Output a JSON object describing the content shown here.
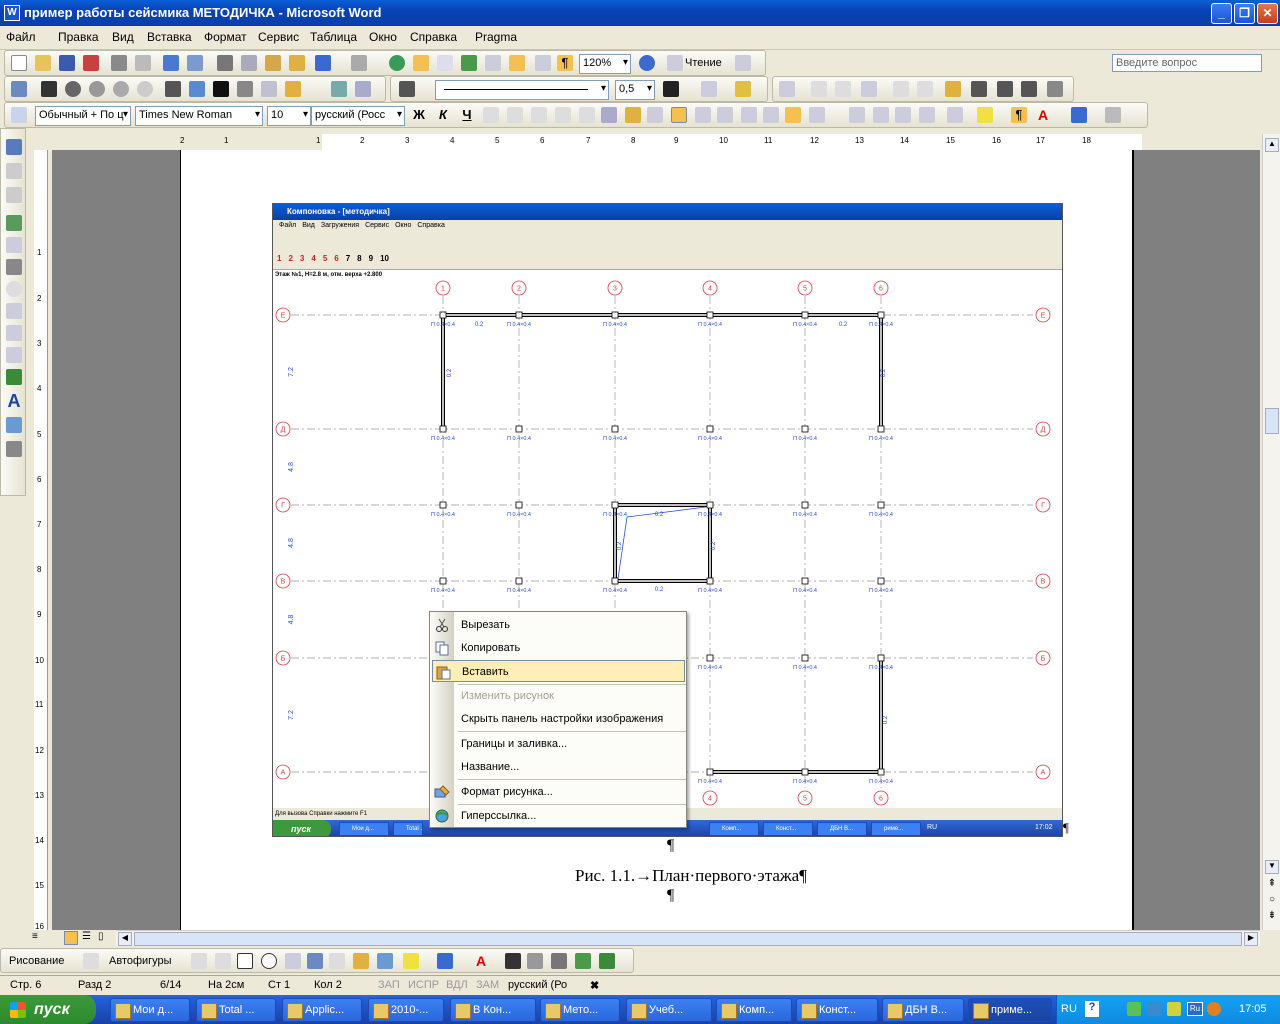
{
  "window": {
    "title": "пример работы сейсмика МЕТОДИЧКА - Microsoft Word",
    "app_icon": "W"
  },
  "menu": [
    "Файл",
    "Правка",
    "Вид",
    "Вставка",
    "Формат",
    "Сервис",
    "Таблица",
    "Окно",
    "Справка",
    "Pragma"
  ],
  "ask_placeholder": "Введите вопрос",
  "toolbar_standard": {
    "zoom": "120%",
    "read_label": "Чтение"
  },
  "toolbar_drawing_props": {
    "line_weight": "0,5"
  },
  "toolbar_format": {
    "style": "Обычный + По ц",
    "font": "Times New Roman",
    "size": "10",
    "language": "русский (Росс"
  },
  "ruler_numbers": [
    "2",
    "1",
    "1",
    "2",
    "3",
    "4",
    "5",
    "6",
    "7",
    "8",
    "9",
    "10",
    "11",
    "12",
    "13",
    "14",
    "15",
    "16",
    "17",
    "18"
  ],
  "vruler_numbers": [
    "1",
    "2",
    "3",
    "4",
    "5",
    "6",
    "7",
    "8",
    "9",
    "10",
    "11",
    "12",
    "13",
    "14",
    "15",
    "16"
  ],
  "embedded": {
    "title": "Компоновка - [методичка]",
    "menu": [
      "Файл",
      "Вид",
      "Загружения",
      "Сервис",
      "Окно",
      "Справка"
    ],
    "floor_tabs": [
      "1",
      "2",
      "3",
      "4",
      "5",
      "6",
      "7",
      "8",
      "9",
      "10"
    ],
    "info": "Этаж №1, Н=2.8 м, отм. верха +2.800",
    "status": "Для вызова Справки нажмите F1",
    "axes_top": [
      "1",
      "2",
      "3",
      "4",
      "5",
      "6"
    ],
    "axes_left": [
      "Е",
      "Д",
      "Г",
      "В",
      "Б",
      "А"
    ],
    "spans": [
      "7.2",
      "4.8",
      "4.8",
      "4.8",
      "7.2"
    ],
    "node_label": "П 0.4×0.4",
    "wall_label": "0.2",
    "taskbar": {
      "start": "пуск",
      "items": [
        "Мои д...",
        "Total ...",
        "",
        "",
        "",
        "",
        "",
        "Комп...",
        "Конст...",
        "ДБН В...",
        "риме..."
      ],
      "lang": "RU",
      "clock": "17:02"
    }
  },
  "caption": "Рис. 1.1.→План·первого·этажа¶",
  "pilcrow": "¶",
  "context_menu": [
    {
      "label": "Вырезать",
      "icon": "scissors-icon",
      "enabled": true
    },
    {
      "label": "Копировать",
      "icon": "copy-icon",
      "enabled": true
    },
    {
      "label": "Вставить",
      "icon": "paste-icon",
      "enabled": true,
      "highlighted": true
    },
    {
      "label": "Изменить рисунок",
      "enabled": false
    },
    {
      "label": "Скрыть панель настройки изображения",
      "enabled": true
    },
    {
      "label": "Границы и заливка...",
      "enabled": true
    },
    {
      "label": "Название...",
      "enabled": true
    },
    {
      "label": "Формат рисунка...",
      "icon": "format-picture-icon",
      "enabled": true
    },
    {
      "label": "Гиперссылка...",
      "icon": "hyperlink-icon",
      "enabled": true
    }
  ],
  "drawing_bar": {
    "draw_label": "Рисование",
    "autoshapes_label": "Автофигуры"
  },
  "status": {
    "page": "Стр. 6",
    "section": "Разд 2",
    "pages": "6/14",
    "at": "На 2см",
    "line": "Ст 1",
    "col": "Кол 2",
    "rec": "ЗАП",
    "trk": "ИСПР",
    "ext": "ВДЛ",
    "ovr": "ЗАМ",
    "lang": "русский (Ро"
  },
  "taskbar": {
    "start": "пуск",
    "items": [
      "Мои д...",
      "Total ...",
      "Applic...",
      "2010-...",
      "В Кон...",
      "Мето...",
      "Учеб...",
      "Комп...",
      "Конст...",
      "ДБН В...",
      "приме..."
    ],
    "active_index": 10,
    "lang": "RU",
    "clock": "17:05"
  },
  "colors": {
    "xp_blue": "#0a3fa8",
    "highlight": "#ffeeb7",
    "plan_blue": "#2a4bd8",
    "axis_red": "#d04040"
  }
}
